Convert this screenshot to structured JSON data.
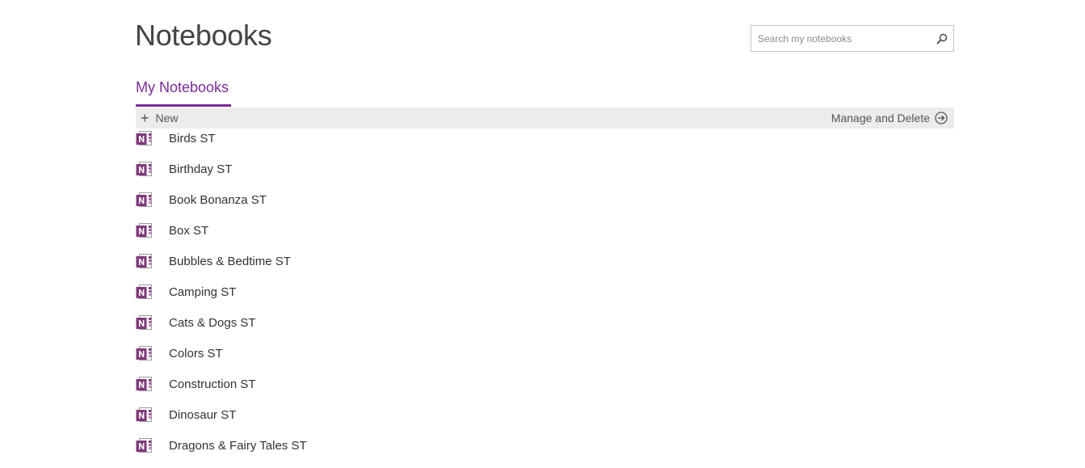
{
  "header": {
    "title": "Notebooks"
  },
  "search": {
    "placeholder": "Search my notebooks",
    "icon": "search-icon"
  },
  "tabs": [
    {
      "label": "My Notebooks",
      "active": true
    }
  ],
  "toolbar": {
    "new_label": "New",
    "manage_label": "Manage and Delete"
  },
  "notebooks": [
    {
      "name": "Birds ST"
    },
    {
      "name": "Birthday ST"
    },
    {
      "name": "Book Bonanza ST"
    },
    {
      "name": "Box ST"
    },
    {
      "name": "Bubbles & Bedtime ST"
    },
    {
      "name": "Camping ST"
    },
    {
      "name": "Cats & Dogs ST"
    },
    {
      "name": "Colors ST"
    },
    {
      "name": "Construction ST"
    },
    {
      "name": "Dinosaur ST"
    },
    {
      "name": "Dragons & Fairy Tales ST"
    }
  ],
  "colors": {
    "accent": "#7a2a9a",
    "toolbar_bg": "#ececec",
    "onenote_icon": "#80397b"
  }
}
